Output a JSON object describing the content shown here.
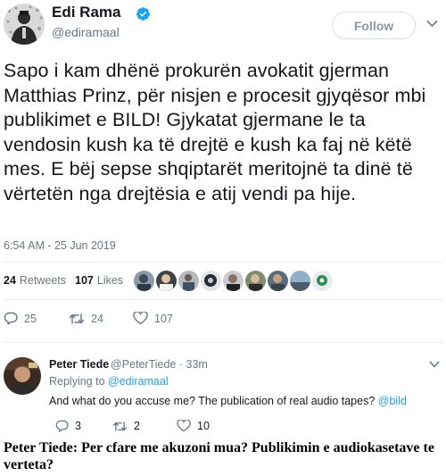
{
  "tweet": {
    "author": {
      "display_name": "Edi Rama",
      "handle": "@ediramaal",
      "verified": true
    },
    "follow_label": "Follow",
    "text": "Sapo i kam dhënë prokurën avokatit gjerman Matthias Prinz, për nisjen e procesit gjyqësor mbi publikimet e BILD! Gjykatat gjermane le ta vendosin kush ka të drejtë e kush ka faj në këtë mes. E bëj sepse shqiptarët meritojnë ta dinë të vërtetën nga drejtësia e atij vendi pa hije.",
    "timestamp": "6:54 AM - 25 Jun 2019",
    "stats": {
      "retweets_count": "24",
      "retweets_label": "Retweets",
      "likes_count": "107",
      "likes_label": "Likes"
    },
    "actions": {
      "replies": "25",
      "retweets": "24",
      "likes": "107"
    }
  },
  "reply": {
    "author_name": "Peter Tiede",
    "author_handle": "@PeterTiede",
    "separator": "·",
    "time": "33m",
    "replying_to_label": "Replying to",
    "replying_to_handle": "@ediramaal",
    "text": "And what do you accuse me?  The publication of real audio tapes?",
    "mention": "@bild",
    "actions": {
      "replies": "3",
      "retweets": "2",
      "likes": "10"
    }
  },
  "caption": "Peter Tiede: Per cfare me akuzoni mua? Publikimin e audiokasetave te verteta?",
  "colors": {
    "accent": "#1da1f2",
    "muted": "#657786",
    "text": "#14171a",
    "divider": "#e6ecf0"
  }
}
